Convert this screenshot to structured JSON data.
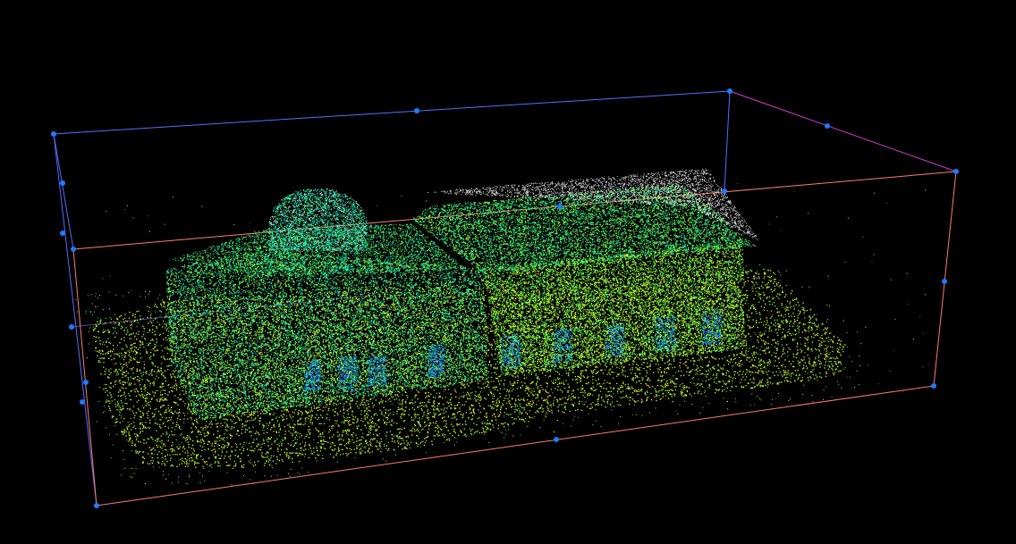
{
  "viewer": {
    "background_color": "#000000",
    "point_cloud": {
      "subject": "building",
      "color_scale": [
        "#1a6cff",
        "#19e0c8",
        "#22f07a",
        "#7cf23a",
        "#c8f52a",
        "#f0ff2a"
      ],
      "roof_color": "#d8d8d8"
    },
    "bounding_box": {
      "edge_color_blue": "#5a6cff",
      "edge_color_magenta": "#d43cd6",
      "edge_color_salmon": "#ff7a7a",
      "handle_color": "#1e7bff"
    }
  }
}
